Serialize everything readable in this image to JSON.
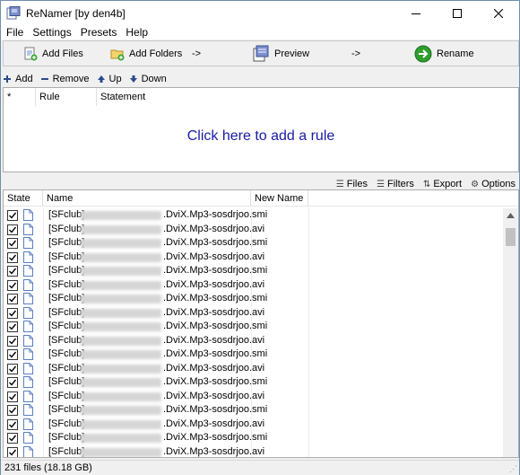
{
  "window": {
    "title": "ReNamer  [by den4b]"
  },
  "menu": [
    "File",
    "Settings",
    "Presets",
    "Help"
  ],
  "toolbar": {
    "add_files": "Add Files",
    "add_folders": "Add Folders",
    "arrow1": "->",
    "preview": "Preview",
    "arrow2": "->",
    "rename": "Rename"
  },
  "rules_toolbar": {
    "add": "Add",
    "remove": "Remove",
    "up": "Up",
    "down": "Down"
  },
  "rules_grid": {
    "columns": [
      "*",
      "Rule",
      "Statement"
    ],
    "empty_text": "Click here to add a rule"
  },
  "files_toolbar": {
    "files": "Files",
    "filters": "Filters",
    "export": "Export",
    "options": "Options"
  },
  "files_grid": {
    "columns": [
      "State",
      "Name",
      "New Name"
    ],
    "rows": [
      {
        "prefix": "[SFclub]",
        "suffix": ".DviX.Mp3-sosdrjoo.smi",
        "checked": true
      },
      {
        "prefix": "[SFclub]",
        "suffix": ".DviX.Mp3-sosdrjoo.avi",
        "checked": true
      },
      {
        "prefix": "[SFclub]",
        "suffix": ".DviX.Mp3-sosdrjoo.smi",
        "checked": true
      },
      {
        "prefix": "[SFclub]",
        "suffix": ".DviX.Mp3-sosdrjoo.avi",
        "checked": true
      },
      {
        "prefix": "[SFclub]",
        "suffix": ".DviX.Mp3-sosdrjoo.smi",
        "checked": true
      },
      {
        "prefix": "[SFclub]",
        "suffix": ".DviX.Mp3-sosdrjoo.avi",
        "checked": true
      },
      {
        "prefix": "[SFclub]",
        "suffix": ".DviX.Mp3-sosdrjoo.smi",
        "checked": true
      },
      {
        "prefix": "[SFclub]",
        "suffix": ".DviX.Mp3-sosdrjoo.avi",
        "checked": true
      },
      {
        "prefix": "[SFclub]",
        "suffix": ".DviX.Mp3-sosdrjoo.smi",
        "checked": true
      },
      {
        "prefix": "[SFclub]",
        "suffix": ".DviX.Mp3-sosdrjoo.avi",
        "checked": true
      },
      {
        "prefix": "[SFclub]",
        "suffix": ".DviX.Mp3-sosdrjoo.smi",
        "checked": true
      },
      {
        "prefix": "[SFclub]",
        "suffix": ".DviX.Mp3-sosdrjoo.avi",
        "checked": true
      },
      {
        "prefix": "[SFclub]",
        "suffix": ".DviX.Mp3-sosdrjoo.smi",
        "checked": true
      },
      {
        "prefix": "[SFclub]",
        "suffix": ".DviX.Mp3-sosdrjoo.avi",
        "checked": true
      },
      {
        "prefix": "[SFclub]",
        "suffix": ".DviX.Mp3-sosdrjoo.smi",
        "checked": true
      },
      {
        "prefix": "[SFclub]",
        "suffix": ".DviX.Mp3-sosdrjoo.avi",
        "checked": true
      },
      {
        "prefix": "[SFclub]",
        "suffix": ".DviX.Mp3-sosdrjoo.smi",
        "checked": true
      },
      {
        "prefix": "[SFclub]",
        "suffix": ".DviX.Mp3-sosdrjoo.avi",
        "checked": true
      }
    ]
  },
  "status": {
    "text": "231 files (18.18 GB)"
  },
  "colors": {
    "accent_text": "#1a1aa6",
    "rename_green": "#2e9e2e"
  }
}
